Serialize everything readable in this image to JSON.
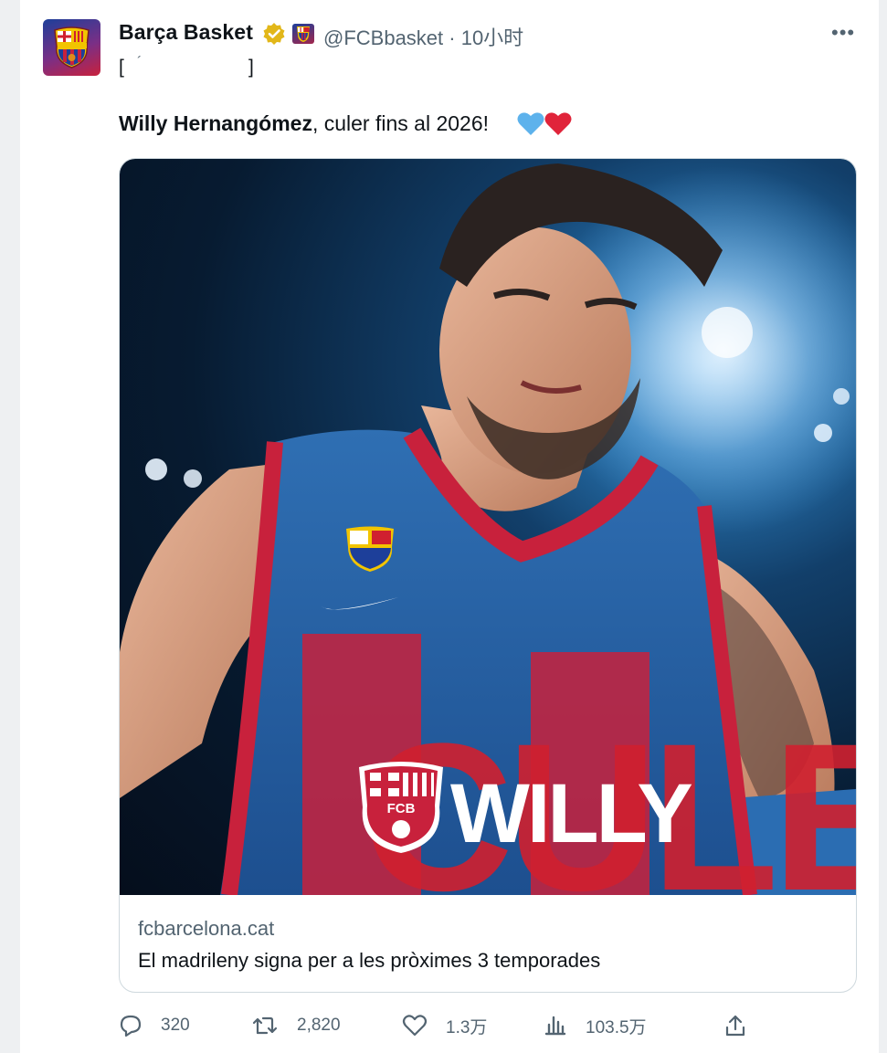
{
  "tweet": {
    "author_name": "Barça Basket",
    "handle_time": "@FCBbasket · 10小时",
    "more_label": "•••",
    "bracket_open": "[",
    "bracket_mark": "´",
    "bracket_close": "]",
    "text_bold": "Willy Hernangómez",
    "text_rest": ", culer fins al 2026!",
    "hearts": [
      "blue-heart",
      "red-heart"
    ]
  },
  "card": {
    "image_text_1": "CULER",
    "image_text_2": "WILLY",
    "crest_text": "FCB",
    "domain": "fcbarcelona.cat",
    "title": "El madrileny signa per a les pròximes 3 temporades"
  },
  "actions": {
    "reply_count": "320",
    "retweet_count": "2,820",
    "like_count": "1.3万",
    "views_count": "103.5万"
  },
  "colors": {
    "blaugrana_blue": "#1d3f9a",
    "blaugrana_red": "#c8213c",
    "verified_gold": "#e2b719",
    "text_secondary": "#536471"
  }
}
